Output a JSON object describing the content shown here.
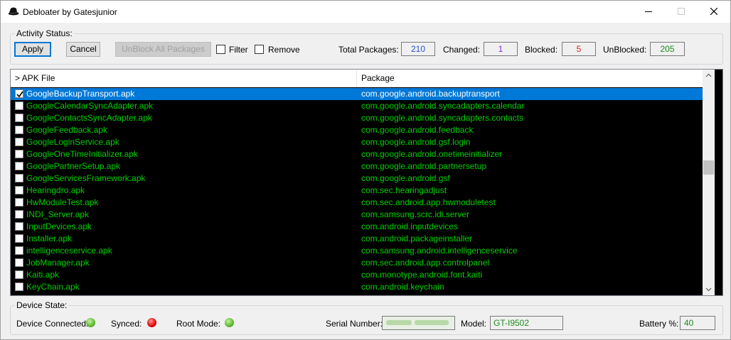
{
  "window": {
    "title": "Debloater by Gatesjunior"
  },
  "activity": {
    "legend": "Activity Status:",
    "apply_label": "Apply",
    "cancel_label": "Cancel",
    "unblock_all_label": "UnBlock All Packages",
    "filter_label": "Filter",
    "remove_label": "Remove",
    "total_label": "Total Packages:",
    "total_value": "210",
    "changed_label": "Changed:",
    "changed_value": "1",
    "blocked_label": "Blocked:",
    "blocked_value": "5",
    "unblocked_label": "UnBlocked:",
    "unblocked_value": "205"
  },
  "colors": {
    "total": "#2a4fd8",
    "changed": "#7a2ad8",
    "blocked": "#e02020",
    "unblocked": "#1e8c1e",
    "row_text": "#00d000",
    "selection": "#0078d7"
  },
  "list": {
    "col_apk": "> APK File",
    "col_package": "Package",
    "rows": [
      {
        "apk": "GoogleBackupTransport.apk",
        "pkg": "com.google.android.backuptransport",
        "checked": true,
        "selected": true
      },
      {
        "apk": "GoogleCalendarSyncAdapter.apk",
        "pkg": "com.google.android.syncadapters.calendar",
        "checked": false,
        "selected": false
      },
      {
        "apk": "GoogleContactsSyncAdapter.apk",
        "pkg": "com.google.android.syncadapters.contacts",
        "checked": false,
        "selected": false
      },
      {
        "apk": "GoogleFeedback.apk",
        "pkg": "com.google.android.feedback",
        "checked": false,
        "selected": false
      },
      {
        "apk": "GoogleLoginService.apk",
        "pkg": "com.google.android.gsf.login",
        "checked": false,
        "selected": false
      },
      {
        "apk": "GoogleOneTimeInitializer.apk",
        "pkg": "com.google.android.onetimeinitializer",
        "checked": false,
        "selected": false
      },
      {
        "apk": "GooglePartnerSetup.apk",
        "pkg": "com.google.android.partnersetup",
        "checked": false,
        "selected": false
      },
      {
        "apk": "GoogleServicesFramework.apk",
        "pkg": "com.google.android.gsf",
        "checked": false,
        "selected": false
      },
      {
        "apk": "Hearingdro.apk",
        "pkg": "com.sec.hearingadjust",
        "checked": false,
        "selected": false
      },
      {
        "apk": "HwModuleTest.apk",
        "pkg": "com.sec.android.app.hwmoduletest",
        "checked": false,
        "selected": false
      },
      {
        "apk": "INDI_Server.apk",
        "pkg": "com.samsung.scrc.idi.server",
        "checked": false,
        "selected": false
      },
      {
        "apk": "InputDevices.apk",
        "pkg": "com.android.inputdevices",
        "checked": false,
        "selected": false
      },
      {
        "apk": "Installer.apk",
        "pkg": "com.android.packageinstaller",
        "checked": false,
        "selected": false
      },
      {
        "apk": "intelligenceservice.apk",
        "pkg": "com.samsung.android.intelligenceservice",
        "checked": false,
        "selected": false
      },
      {
        "apk": "JobManager.apk",
        "pkg": "com.sec.android.app.controlpanel",
        "checked": false,
        "selected": false
      },
      {
        "apk": "Kaiti.apk",
        "pkg": "com.monotype.android.font.kaiti",
        "checked": false,
        "selected": false
      },
      {
        "apk": "KeyChain.apk",
        "pkg": "com.android.keychain",
        "checked": false,
        "selected": false
      }
    ]
  },
  "device": {
    "legend": "Device State:",
    "connected_label": "Device Connected:",
    "connected_status": "green",
    "synced_label": "Synced:",
    "synced_status": "red",
    "root_label": "Root Mode:",
    "root_status": "green",
    "serial_label": "Serial Number:",
    "model_label": "Model:",
    "model_value": "GT-I9502",
    "battery_label": "Battery %:",
    "battery_value": "40"
  },
  "icons": {
    "app": "hat-icon",
    "minimize": "minimize-icon",
    "maximize": "maximize-icon",
    "close": "close-icon",
    "scroll_up": "chevron-up-icon",
    "scroll_down": "chevron-down-icon"
  }
}
